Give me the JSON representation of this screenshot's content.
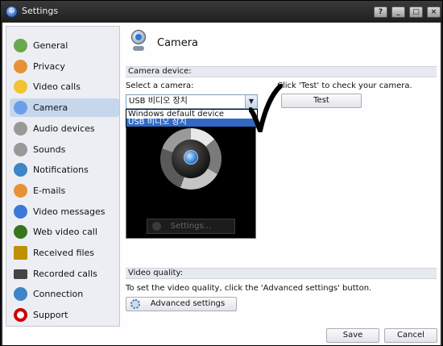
{
  "window": {
    "title": "Settings",
    "title_icon": "gear-icon",
    "controls": [
      "?",
      "_",
      "□",
      "×"
    ]
  },
  "sidebar": {
    "items": [
      {
        "label": "General",
        "icon": "general-icon",
        "color": "#6aa84f"
      },
      {
        "label": "Privacy",
        "icon": "privacy-icon",
        "color": "#e69138"
      },
      {
        "label": "Video calls",
        "icon": "video-calls-icon",
        "color": "#f1c232"
      },
      {
        "label": "Camera",
        "icon": "camera-icon",
        "color": "#6d9eeb",
        "active": true
      },
      {
        "label": "Audio devices",
        "icon": "audio-devices-icon",
        "color": "#999999"
      },
      {
        "label": "Sounds",
        "icon": "sounds-icon",
        "color": "#999999"
      },
      {
        "label": "Notifications",
        "icon": "notifications-icon",
        "color": "#3d85c6"
      },
      {
        "label": "E-mails",
        "icon": "emails-icon",
        "color": "#e69138"
      },
      {
        "label": "Video messages",
        "icon": "video-messages-icon",
        "color": "#3c78d8"
      },
      {
        "label": "Web video call",
        "icon": "web-video-call-icon",
        "color": "#38761d"
      },
      {
        "label": "Received files",
        "icon": "received-files-icon",
        "color": "#bf9000"
      },
      {
        "label": "Recorded calls",
        "icon": "recorded-calls-icon",
        "color": "#444444"
      },
      {
        "label": "Connection",
        "icon": "connection-icon",
        "color": "#3d85c6"
      },
      {
        "label": "Support",
        "icon": "support-icon",
        "color": "#cc0000"
      }
    ]
  },
  "main": {
    "page_title": "Camera",
    "camera_device_header": "Camera device:",
    "select_label": "Select a camera:",
    "test_hint": "Click 'Test' to check your camera.",
    "camera_select_value": "USB 비디오 장치",
    "camera_options": [
      "Windows default device",
      "USB 비디오 장치"
    ],
    "camera_options_selected_index": 1,
    "test_button": "Test",
    "preview_settings_button": "Settings...",
    "video_quality_header": "Video quality:",
    "video_quality_text": "To set the video quality, click the 'Advanced settings' button.",
    "advanced_settings_button": "Advanced settings"
  },
  "footer": {
    "save_label": "Save",
    "cancel_label": "Cancel"
  }
}
